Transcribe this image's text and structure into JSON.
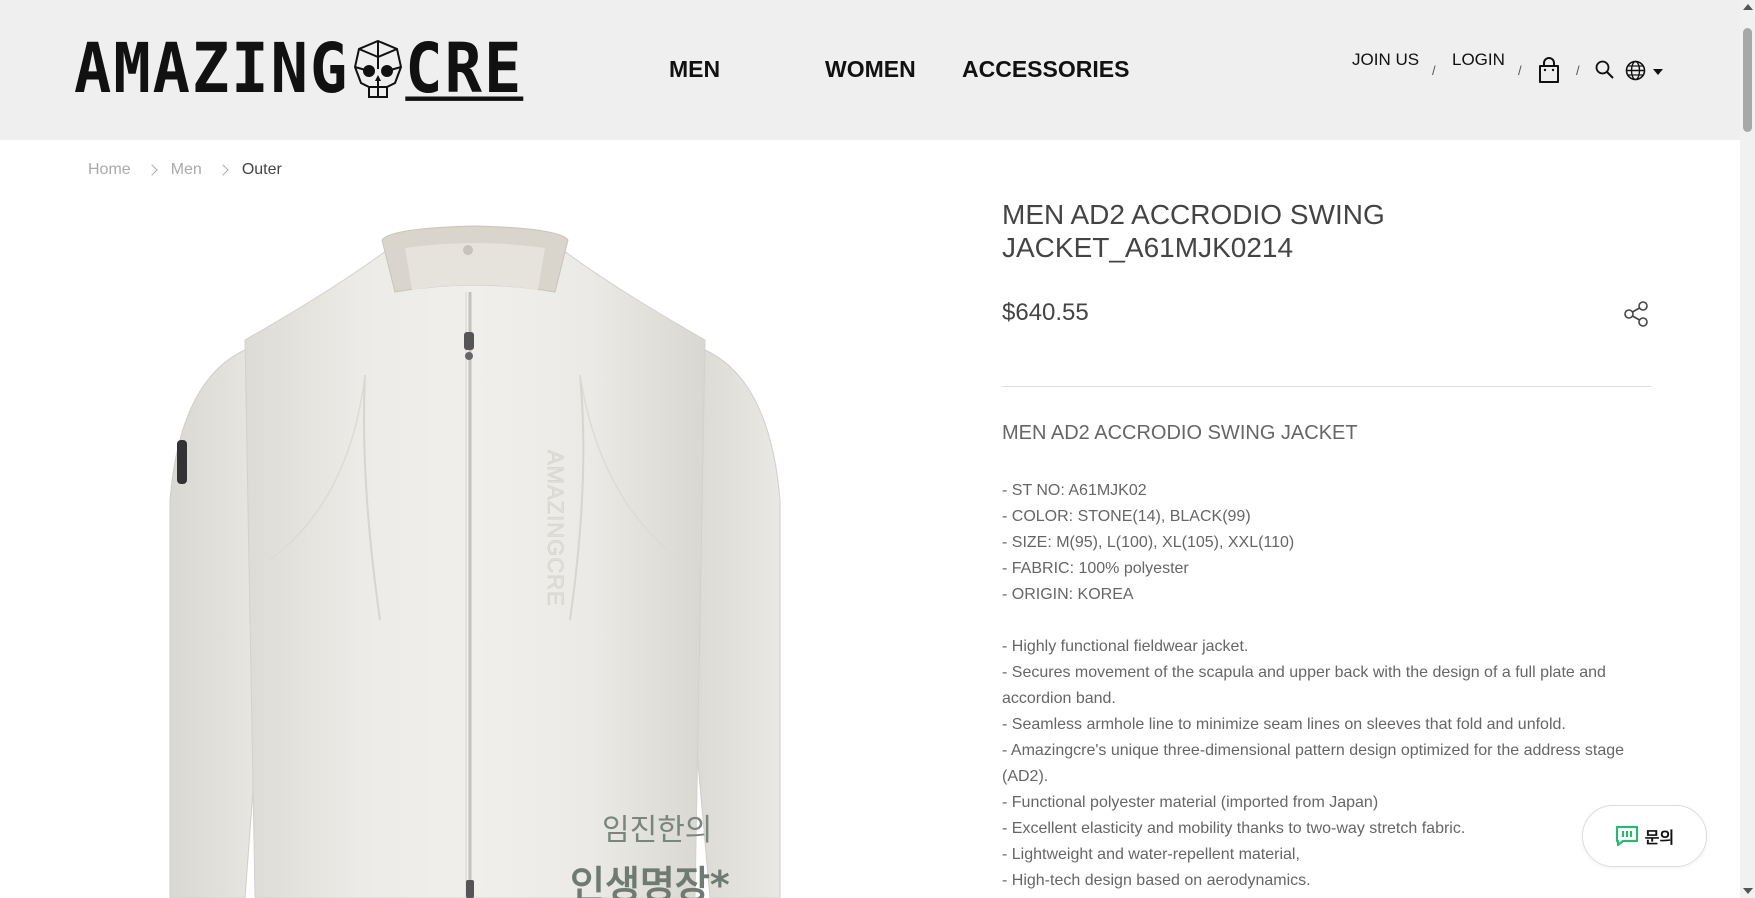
{
  "header": {
    "logo_text_1": "AMAZING",
    "logo_text_2": "CRE",
    "nav": [
      "MEN",
      "WOMEN",
      "ACCESSORIES"
    ],
    "join_label": "JOIN US",
    "login_label": "LOGIN",
    "separator": "/"
  },
  "breadcrumb": [
    "Home",
    "Men",
    "Outer"
  ],
  "product": {
    "title": "MEN AD2 ACCRODIO SWING JACKET_A61MJK0214",
    "price": "$640.55",
    "description_title": "MEN AD2 ACCRODIO SWING JACKET",
    "specs": [
      "- ST NO: A61MJK02",
      "- COLOR: STONE(14), BLACK(99)",
      "- SIZE: M(95), L(100), XL(105), XXL(110)",
      "- FABRIC: 100% polyester",
      "- ORIGIN: KOREA"
    ],
    "features": [
      "- Highly functional fieldwear jacket.",
      "- Secures movement of the scapula and upper back with the design of a full plate and accordion band.",
      "- Seamless armhole line to minimize seam lines on sleeves that fold and unfold.",
      "- Amazingcre's unique three-dimensional pattern design optimized for the address stage (AD2).",
      "- Functional polyester material (imported from Japan)",
      "- Excellent elasticity and mobility thanks to two-way stretch fabric.",
      "- Lightweight and water-repellent material,",
      "- High-tech design based on aerodynamics."
    ],
    "image_overlay_text": "임진한의"
  },
  "inquiry": {
    "label": "문의"
  },
  "colors": {
    "header_bg": "#efefef",
    "inquiry_icon": "#2bb673",
    "text_muted": "#666666"
  },
  "icons": [
    "skull-logo-icon",
    "shopping-bag-icon",
    "search-icon",
    "globe-icon",
    "caret-down-icon",
    "share-icon",
    "chat-icon",
    "chevron-right-icon"
  ]
}
